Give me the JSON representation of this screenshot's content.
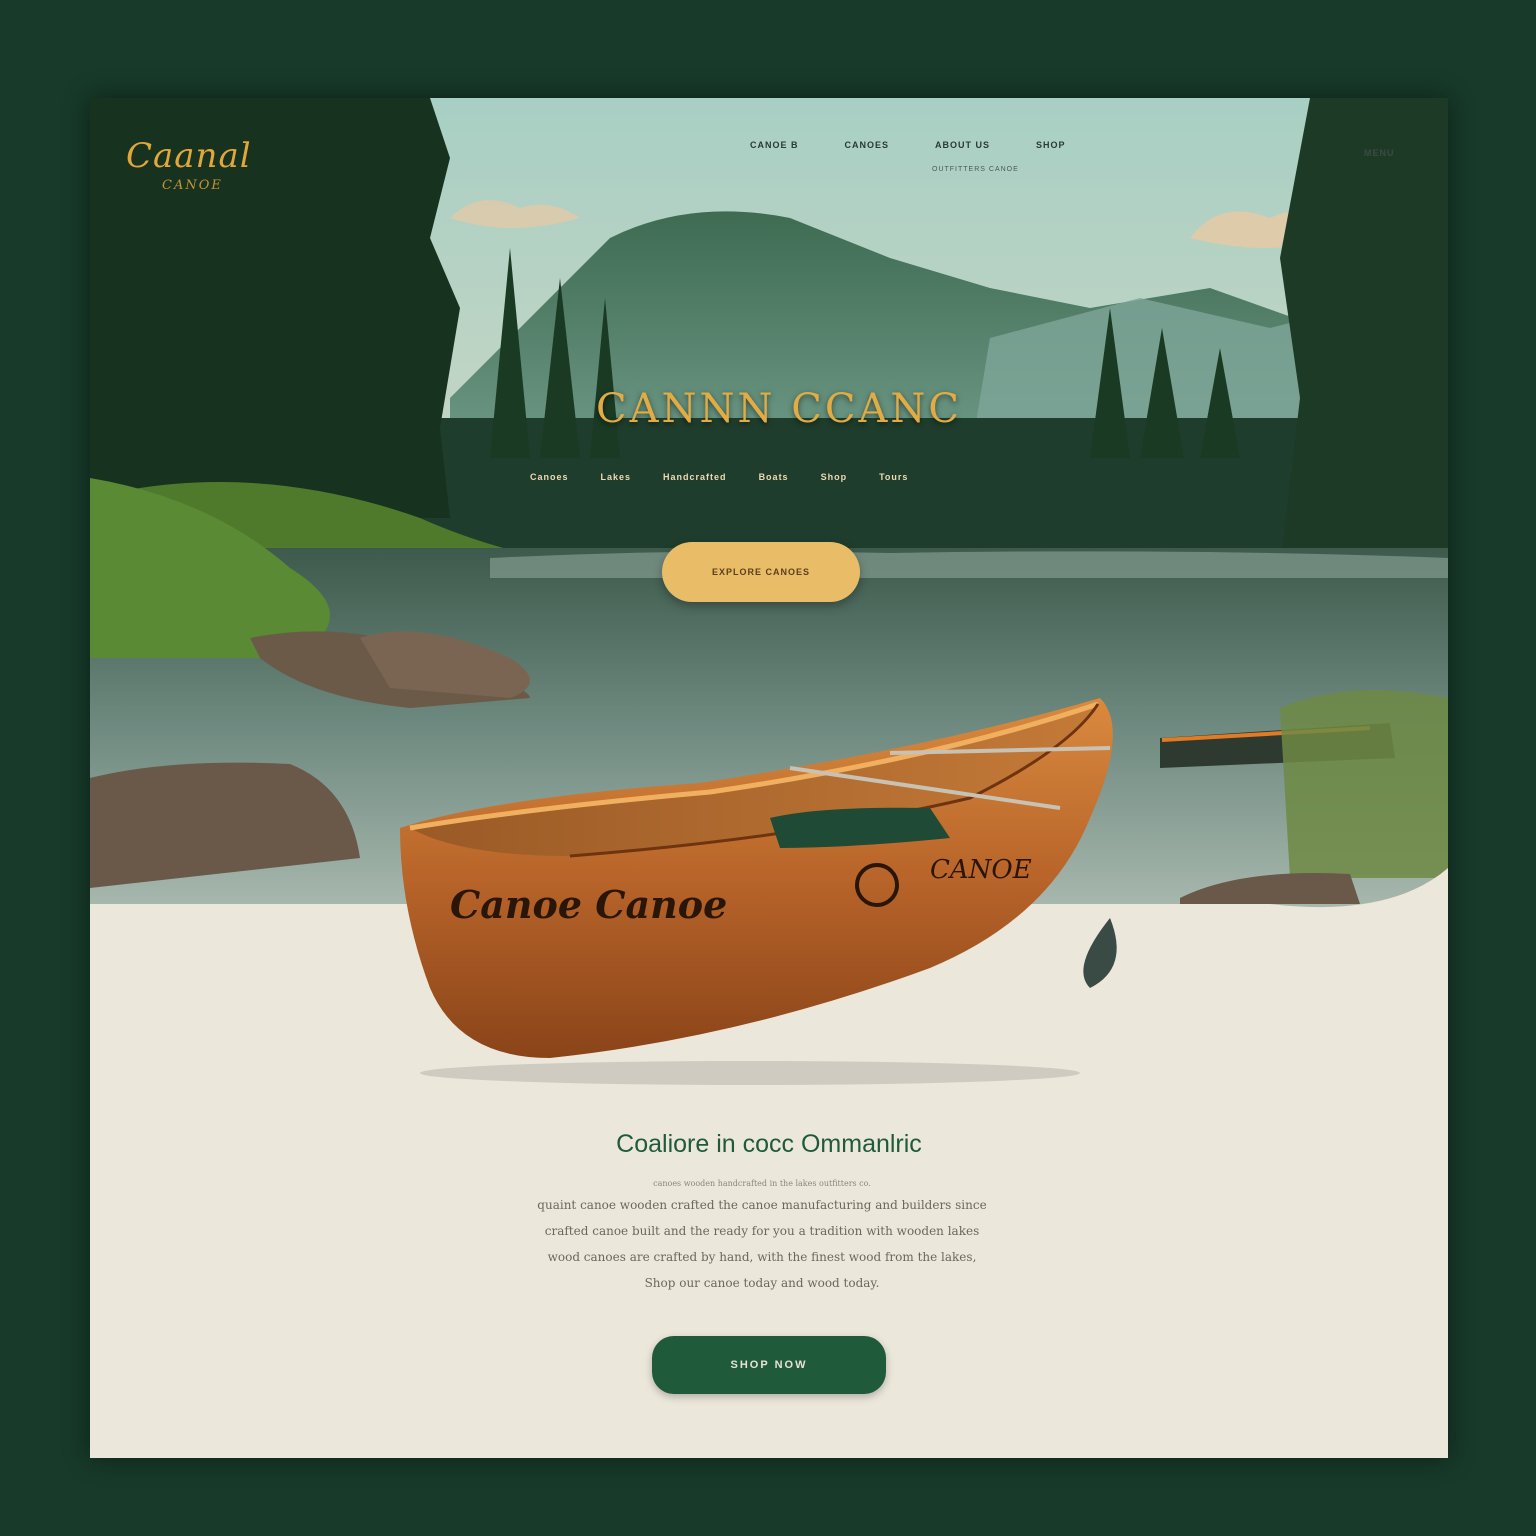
{
  "brand": {
    "logo_text": "Caanal",
    "logo_subtext": "CANOE"
  },
  "nav": {
    "items": [
      "CANOE B",
      "CANOES",
      "ABOUT US",
      "SHOP"
    ],
    "sub_text": "OUTFITTERS CANOE",
    "right_label": "MENU"
  },
  "hero": {
    "title": "CANNN CCANC",
    "tags": [
      "Canoes",
      "Lakes",
      "Handcrafted",
      "Boats",
      "Shop",
      "Tours"
    ],
    "button_label": "EXPLORE CANOES"
  },
  "canoe": {
    "hull_text": "Canoe Canoe",
    "stern_text": "CANOE"
  },
  "section": {
    "title": "Coaliore in cocc Ommanlric",
    "lines": [
      "canoes wooden handcrafted in the lakes outfitters co.",
      "quaint canoe wooden crafted the canoe manufacturing and builders since",
      "crafted canoe built and the ready for you a tradition with wooden lakes",
      "wood canoes are crafted by hand, with the finest wood from the lakes,",
      "Shop our canoe today and wood today."
    ],
    "button_label": "SHOP NOW"
  },
  "colors": {
    "background": "#173a2a",
    "accent_gold": "#e2ac44",
    "button_gold": "#e9bd68",
    "brand_green": "#1f5a3b",
    "paper": "#ece7db"
  }
}
